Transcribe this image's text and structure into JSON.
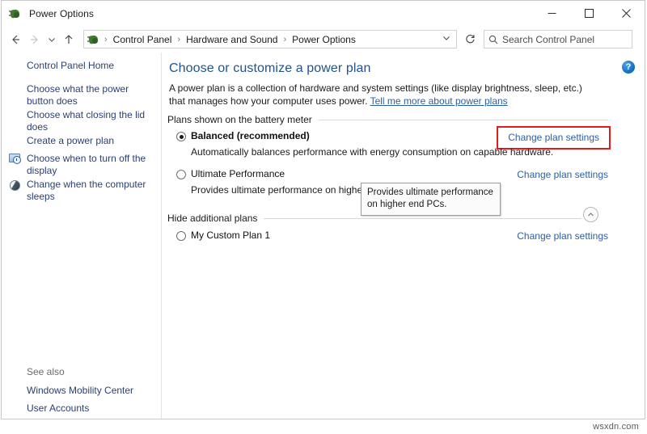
{
  "window": {
    "title": "Power Options",
    "icon": "power-plug-icon",
    "controls": {
      "minimize": "minimize-button",
      "maximize": "maximize-button",
      "close": "close-button"
    }
  },
  "navbar": {
    "back": "back-arrow",
    "forward": "forward-arrow",
    "recent": "recent-locations-chevron",
    "up": "up-arrow",
    "breadcrumb": [
      "Control Panel",
      "Hardware and Sound",
      "Power Options"
    ],
    "separator": "›",
    "refresh": "refresh-icon",
    "search": {
      "placeholder": "Search Control Panel",
      "value": "",
      "icon": "search-icon"
    }
  },
  "sidebar": {
    "home": "Control Panel Home",
    "items": [
      {
        "label": "Choose what the power button does",
        "icon": null
      },
      {
        "label": "Choose what closing the lid does",
        "icon": null
      },
      {
        "label": "Create a power plan",
        "icon": null
      },
      {
        "label": "Choose when to turn off the display",
        "icon": "monitor-clock-icon"
      },
      {
        "label": "Change when the computer sleeps",
        "icon": "moon-sleep-icon"
      }
    ],
    "see_also_label": "See also",
    "see_also": [
      "Windows Mobility Center",
      "User Accounts"
    ]
  },
  "main": {
    "help_icon": "help-icon",
    "help_glyph": "?",
    "title": "Choose or customize a power plan",
    "description_part1": "A power plan is a collection of hardware and system settings (like display brightness, sleep, etc.) that manages how your computer uses power. ",
    "description_link": "Tell me more about power plans",
    "section_battery": "Plans shown on the battery meter",
    "section_additional": "Hide additional plans",
    "collapse_glyph": "⌃",
    "change_link_label": "Change plan settings",
    "plans": [
      {
        "name": "Balanced (recommended)",
        "description": "Automatically balances performance with energy consumption on capable hardware.",
        "selected": true,
        "highlighted": true
      },
      {
        "name": "Ultimate Performance",
        "description": "Provides ultimate performance on higher end PCs.",
        "selected": false,
        "highlighted": false
      },
      {
        "name": "My Custom Plan 1",
        "description": "",
        "selected": false,
        "highlighted": false
      }
    ],
    "tooltip": "Provides ultimate performance on higher end PCs."
  },
  "watermark": "wsxdn.com",
  "colors": {
    "link": "#2b5fa5",
    "title": "#20538d",
    "highlight_border": "#e01b1b",
    "sidebar_link": "#2b3f73"
  }
}
